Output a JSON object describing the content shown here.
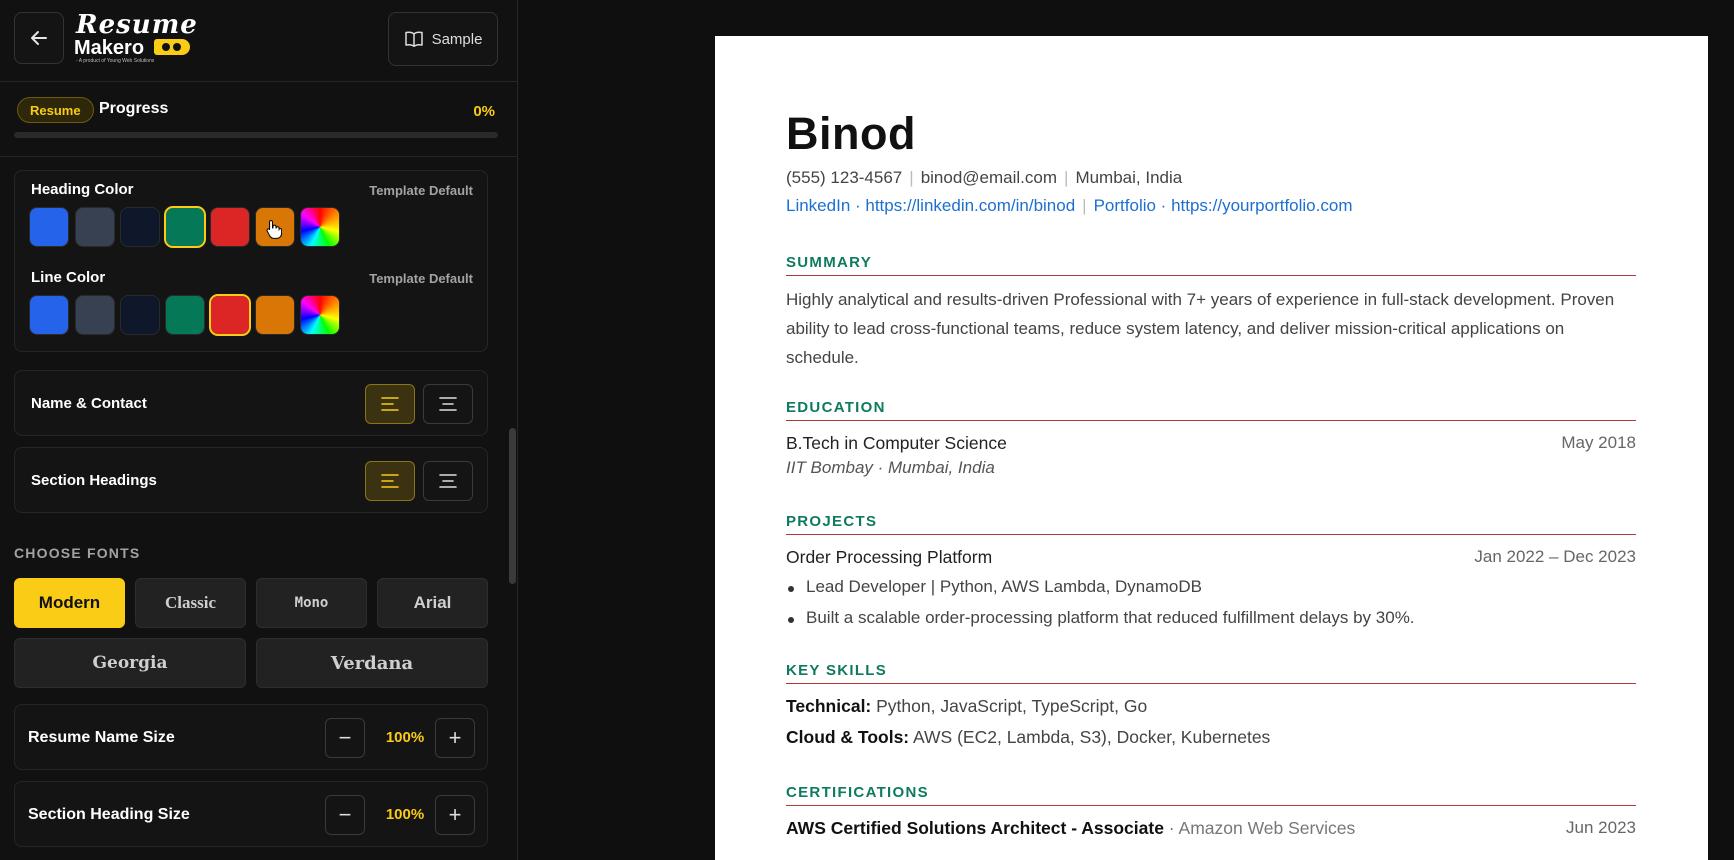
{
  "header": {
    "logo_line1": "Resume",
    "logo_line2": "Makero",
    "logo_tagline": "- A product of Young Web Solutions",
    "sample_label": "Sample"
  },
  "progress": {
    "badge": "Resume",
    "label": "Progress",
    "percent_text": "0%",
    "value": 0
  },
  "colors": {
    "heading_title": "Heading Color",
    "heading_default": "Template Default",
    "line_title": "Line Color",
    "line_default": "Template Default",
    "swatches": [
      "#2563eb",
      "#374151",
      "#0f172a",
      "#047857",
      "#dc2626",
      "#d97706"
    ],
    "heading_selected": 3,
    "line_selected": 4,
    "accent": "#facc15"
  },
  "alignment": {
    "name_contact_label": "Name & Contact",
    "section_headings_label": "Section Headings"
  },
  "fonts": {
    "title": "CHOOSE FONTS",
    "options": [
      "Modern",
      "Classic",
      "Mono",
      "Arial",
      "Georgia",
      "Verdana"
    ],
    "selected": "Modern"
  },
  "sizes": [
    {
      "label": "Resume Name Size",
      "value": "100%"
    },
    {
      "label": "Section Heading Size",
      "value": "100%"
    }
  ],
  "resume": {
    "name": "Binod",
    "phone": "(555) 123-4567",
    "email": "binod@email.com",
    "location": "Mumbai, India",
    "linkedin": "LinkedIn · https://linkedin.com/in/binod",
    "portfolio": "Portfolio · https://yourportfolio.com",
    "summary_head": "SUMMARY",
    "summary": "Highly analytical and results-driven Professional with 7+ years of experience in full-stack development. Proven ability to lead cross-functional teams, reduce system latency, and deliver mission-critical applications on schedule.",
    "education_head": "EDUCATION",
    "degree": "B.Tech in Computer Science",
    "degree_date": "May 2018",
    "school": "IIT Bombay · Mumbai, India",
    "projects_head": "PROJECTS",
    "project_title": "Order Processing Platform",
    "project_date": "Jan 2022 – Dec 2023",
    "project_bullets": [
      "Lead Developer | Python, AWS Lambda, DynamoDB",
      "Built a scalable order-processing platform that reduced fulfillment delays by 30%."
    ],
    "skills_head": "KEY SKILLS",
    "skill1_label": "Technical:",
    "skill1_value": " Python, JavaScript, TypeScript, Go",
    "skill2_label": "Cloud & Tools:",
    "skill2_value": " AWS (EC2, Lambda, S3), Docker, Kubernetes",
    "cert_head": "CERTIFICATIONS",
    "cert_title": "AWS Certified Solutions Architect - Associate",
    "cert_issuer": " · Amazon Web Services",
    "cert_date": "Jun 2023",
    "heading_color": "#0e7a5f",
    "line_color": "#b03a3a"
  }
}
